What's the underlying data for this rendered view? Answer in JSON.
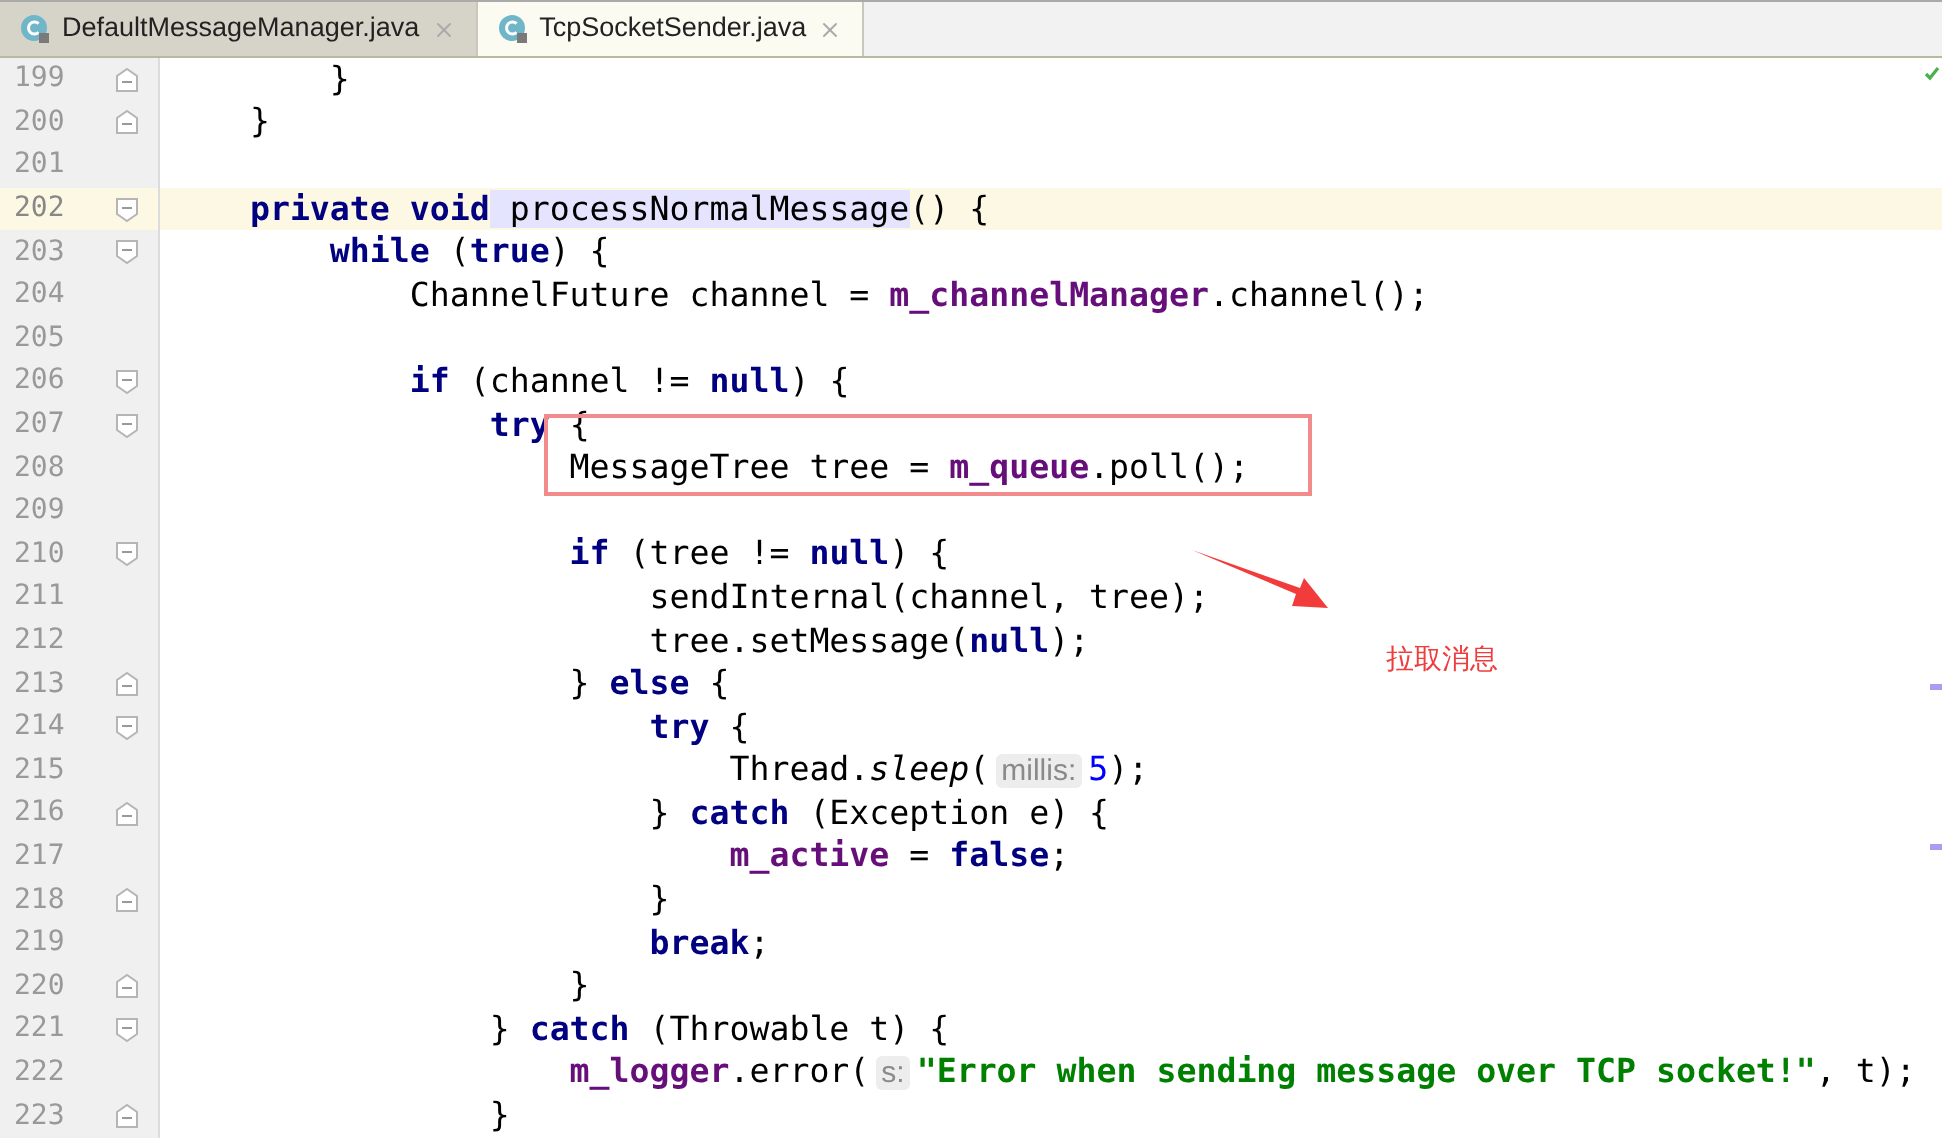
{
  "tabs": [
    {
      "label": "DefaultMessageManager.java",
      "selected": false
    },
    {
      "label": "TcpSocketSender.java",
      "selected": true
    }
  ],
  "editor": {
    "lines": [
      {
        "number": "199",
        "fold_start": false,
        "fold_end": true,
        "current": false,
        "tokens": [
          {
            "kind": "plain",
            "text": "        }"
          }
        ]
      },
      {
        "number": "200",
        "fold_start": false,
        "fold_end": true,
        "current": false,
        "tokens": [
          {
            "kind": "plain",
            "text": "    }"
          }
        ]
      },
      {
        "number": "201",
        "fold_start": false,
        "fold_end": false,
        "current": false
      },
      {
        "number": "202",
        "fold_start": true,
        "fold_end": false,
        "current": true,
        "tokens": [
          {
            "kind": "keyword",
            "text": "    private"
          },
          {
            "kind": "keyword",
            "text": " void"
          },
          {
            "kind": "declaration",
            "text": " processNormalMessage"
          },
          {
            "kind": "plain",
            "text": "() {"
          }
        ]
      },
      {
        "number": "203",
        "fold_start": true,
        "fold_end": false,
        "current": false,
        "tokens": [
          {
            "kind": "keyword",
            "text": "        while"
          },
          {
            "kind": "plain",
            "text": " ("
          },
          {
            "kind": "keyword",
            "text": "true"
          },
          {
            "kind": "plain",
            "text": ") {"
          }
        ]
      },
      {
        "number": "204",
        "fold_start": false,
        "fold_end": false,
        "current": false,
        "tokens": [
          {
            "kind": "plain",
            "text": "            ChannelFuture channel = "
          },
          {
            "kind": "field",
            "text": "m_channelManager"
          },
          {
            "kind": "plain",
            "text": ".channel();"
          }
        ]
      },
      {
        "number": "205",
        "fold_start": false,
        "fold_end": false,
        "current": false
      },
      {
        "number": "206",
        "fold_start": true,
        "fold_end": false,
        "current": false,
        "tokens": [
          {
            "kind": "keyword",
            "text": "            if"
          },
          {
            "kind": "plain",
            "text": " (channel != "
          },
          {
            "kind": "keyword",
            "text": "null"
          },
          {
            "kind": "plain",
            "text": ") {"
          }
        ]
      },
      {
        "number": "207",
        "fold_start": true,
        "fold_end": false,
        "current": false,
        "tokens": [
          {
            "kind": "keyword",
            "text": "                try"
          },
          {
            "kind": "plain",
            "text": " {"
          }
        ]
      },
      {
        "number": "208",
        "fold_start": false,
        "fold_end": false,
        "current": false,
        "tokens": [
          {
            "kind": "plain",
            "text": "                    MessageTree tree = "
          },
          {
            "kind": "field",
            "text": "m_queue"
          },
          {
            "kind": "plain",
            "text": ".poll();"
          }
        ]
      },
      {
        "number": "209",
        "fold_start": false,
        "fold_end": false,
        "current": false
      },
      {
        "number": "210",
        "fold_start": true,
        "fold_end": false,
        "current": false,
        "tokens": [
          {
            "kind": "keyword",
            "text": "                    if"
          },
          {
            "kind": "plain",
            "text": " (tree != "
          },
          {
            "kind": "keyword",
            "text": "null"
          },
          {
            "kind": "plain",
            "text": ") {"
          }
        ]
      },
      {
        "number": "211",
        "fold_start": false,
        "fold_end": false,
        "current": false,
        "tokens": [
          {
            "kind": "plain",
            "text": "                        sendInternal(channel, tree);"
          }
        ]
      },
      {
        "number": "212",
        "fold_start": false,
        "fold_end": false,
        "current": false,
        "tokens": [
          {
            "kind": "plain",
            "text": "                        tree.setMessage("
          },
          {
            "kind": "keyword",
            "text": "null"
          },
          {
            "kind": "plain",
            "text": ");"
          }
        ]
      },
      {
        "number": "213",
        "fold_start": false,
        "fold_end": true,
        "current": false,
        "tokens": [
          {
            "kind": "plain",
            "text": "                    } "
          },
          {
            "kind": "keyword",
            "text": "else"
          },
          {
            "kind": "plain",
            "text": " {"
          }
        ]
      },
      {
        "number": "214",
        "fold_start": true,
        "fold_end": false,
        "current": false,
        "tokens": [
          {
            "kind": "keyword",
            "text": "                        try"
          },
          {
            "kind": "plain",
            "text": " {"
          }
        ]
      },
      {
        "number": "215",
        "fold_start": false,
        "fold_end": false,
        "current": false,
        "tokens": [
          {
            "kind": "plain",
            "text": "                            Thread."
          },
          {
            "kind": "static",
            "text": "sleep"
          },
          {
            "kind": "plain",
            "text": "("
          },
          {
            "kind": "hint",
            "text": "millis:"
          },
          {
            "kind": "number",
            "text": "5"
          },
          {
            "kind": "plain",
            "text": ");"
          }
        ]
      },
      {
        "number": "216",
        "fold_start": false,
        "fold_end": true,
        "current": false,
        "tokens": [
          {
            "kind": "plain",
            "text": "                        } "
          },
          {
            "kind": "keyword",
            "text": "catch"
          },
          {
            "kind": "plain",
            "text": " (Exception e) {"
          }
        ]
      },
      {
        "number": "217",
        "fold_start": false,
        "fold_end": false,
        "current": false,
        "tokens": [
          {
            "kind": "field",
            "text": "                            m_active"
          },
          {
            "kind": "plain",
            "text": " = "
          },
          {
            "kind": "keyword",
            "text": "false"
          },
          {
            "kind": "plain",
            "text": ";"
          }
        ]
      },
      {
        "number": "218",
        "fold_start": false,
        "fold_end": true,
        "current": false,
        "tokens": [
          {
            "kind": "plain",
            "text": "                        }"
          }
        ]
      },
      {
        "number": "219",
        "fold_start": false,
        "fold_end": false,
        "current": false,
        "tokens": [
          {
            "kind": "keyword",
            "text": "                        break"
          },
          {
            "kind": "plain",
            "text": ";"
          }
        ]
      },
      {
        "number": "220",
        "fold_start": false,
        "fold_end": true,
        "current": false,
        "tokens": [
          {
            "kind": "plain",
            "text": "                    }"
          }
        ]
      },
      {
        "number": "221",
        "fold_start": true,
        "fold_end": false,
        "current": false,
        "tokens": [
          {
            "kind": "plain",
            "text": "                } "
          },
          {
            "kind": "keyword",
            "text": "catch"
          },
          {
            "kind": "plain",
            "text": " (Throwable t) {"
          }
        ]
      },
      {
        "number": "222",
        "fold_start": false,
        "fold_end": false,
        "current": false,
        "tokens": [
          {
            "kind": "field",
            "text": "                    m_logger"
          },
          {
            "kind": "plain",
            "text": ".error("
          },
          {
            "kind": "hint",
            "text": "s:"
          },
          {
            "kind": "string",
            "text": "\"Error when sending message over TCP socket!\""
          },
          {
            "kind": "plain",
            "text": ", t);"
          }
        ]
      },
      {
        "number": "223",
        "fold_start": false,
        "fold_end": true,
        "current": false,
        "tokens": [
          {
            "kind": "plain",
            "text": "                }"
          }
        ]
      }
    ]
  },
  "annotation": {
    "text": "拉取消息"
  }
}
